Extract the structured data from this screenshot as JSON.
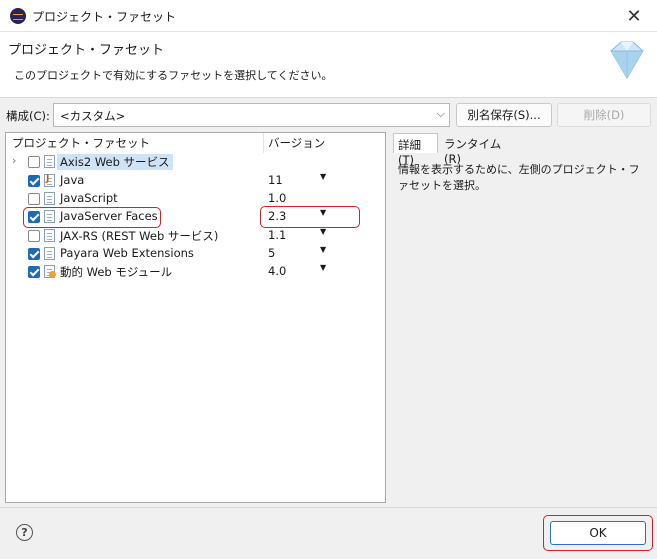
{
  "window": {
    "title": "プロジェクト・ファセット"
  },
  "header": {
    "title": "プロジェクト・ファセット",
    "description": "このプロジェクトで有効にするファセットを選択してください。"
  },
  "config": {
    "label": "構成(C):",
    "value": "<カスタム>",
    "save_as_label": "別名保存(S)...",
    "delete_label": "削除(D)"
  },
  "facets": {
    "col_name": "プロジェクト・ファセット",
    "col_version": "バージョン",
    "rows": [
      {
        "name": "Axis2 Web サービス",
        "version": "",
        "checked": false,
        "expandable": true,
        "selected": true
      },
      {
        "name": "Java",
        "version": "11",
        "checked": true,
        "dropdown": true
      },
      {
        "name": "JavaScript",
        "version": "1.0",
        "checked": false
      },
      {
        "name": "JavaServer Faces",
        "version": "2.3",
        "checked": true,
        "dropdown": true
      },
      {
        "name": "JAX-RS (REST Web サービス)",
        "version": "1.1",
        "checked": false,
        "dropdown": true
      },
      {
        "name": "Payara Web Extensions",
        "version": "5",
        "checked": true,
        "dropdown": true
      },
      {
        "name": "動的 Web モジュール",
        "version": "4.0",
        "checked": true,
        "dropdown": true
      }
    ]
  },
  "tabs": {
    "details": "詳細(T)",
    "runtimes": "ランタイム(R)"
  },
  "details_text": "情報を表示するために、左側のプロジェクト・ファセットを選択。",
  "footer": {
    "ok_label": "OK"
  },
  "colors": {
    "accent": "#1f6ab5",
    "highlight": "#d8202a"
  }
}
